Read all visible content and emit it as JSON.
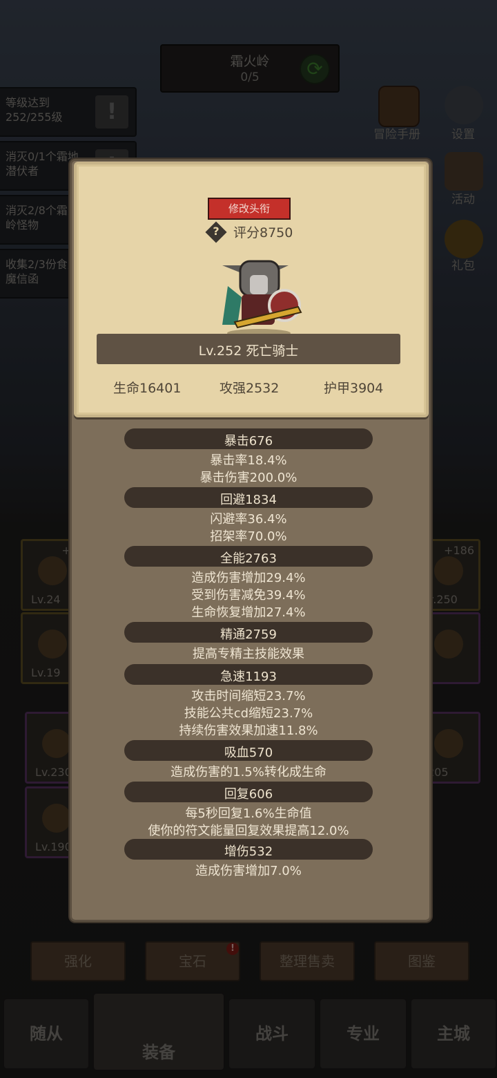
{
  "background": {
    "quest": {
      "title": "霜火岭",
      "progress": "0/5"
    },
    "tasks": [
      {
        "text": "等级达到252/255级"
      },
      {
        "text": "消灭0/1个霜地潜伏者"
      },
      {
        "text": "消灭2/8个霜火岭怪物"
      },
      {
        "text": "收集2/3份食人魔信函"
      }
    ],
    "side_buttons": {
      "handbook": "冒险手册",
      "settings": "设置",
      "events": "活动",
      "gift": "礼包"
    },
    "slots_left": [
      {
        "plus": "+1",
        "level": "Lv.24"
      },
      {
        "level": "Lv.19"
      },
      {
        "level": "Lv.230"
      },
      {
        "level": "Lv.190"
      }
    ],
    "slots_right": [
      {
        "plus": "+186",
        "level": "v.250"
      },
      {
        "level": "205"
      }
    ],
    "action_buttons": [
      "强化",
      "宝石",
      "整理售卖",
      "图鉴"
    ],
    "gem_badge": "!",
    "nav": [
      "随从",
      "装备",
      "战斗",
      "专业",
      "主城"
    ]
  },
  "card": {
    "title_button": "修改头衔",
    "help": "?",
    "score": "评分8750",
    "character": "Lv.252 死亡骑士",
    "stats": {
      "hp": "生命16401",
      "atk": "攻强2532",
      "armor": "护甲3904"
    }
  },
  "sections": [
    {
      "label": "暴击676",
      "lines": [
        "暴击率18.4%",
        "暴击伤害200.0%"
      ]
    },
    {
      "label": "回避1834",
      "lines": [
        "闪避率36.4%",
        "招架率70.0%"
      ]
    },
    {
      "label": "全能2763",
      "lines": [
        "造成伤害增加29.4%",
        "受到伤害减免39.4%",
        "生命恢复增加27.4%"
      ]
    },
    {
      "label": "精通2759",
      "lines": [
        "提高专精主技能效果"
      ]
    },
    {
      "label": "急速1193",
      "lines": [
        "攻击时间缩短23.7%",
        "技能公共cd缩短23.7%",
        "持续伤害效果加速11.8%"
      ]
    },
    {
      "label": "吸血570",
      "lines": [
        "造成伤害的1.5%转化成生命"
      ]
    },
    {
      "label": "回复606",
      "lines": [
        "每5秒回复1.6%生命值",
        "使你的符文能量回复效果提高12.0%"
      ]
    },
    {
      "label": "增伤532",
      "lines": [
        "造成伤害增加7.0%"
      ]
    }
  ]
}
